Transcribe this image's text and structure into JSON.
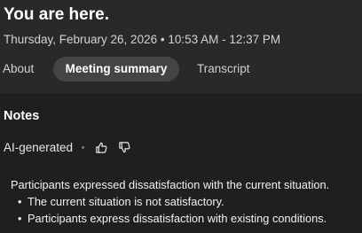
{
  "meeting": {
    "title": "You are here.",
    "datetime": "Thursday, February 26, 2026 • 10:53 AM - 12:37 PM"
  },
  "tabs": [
    {
      "label": "About",
      "selected": false
    },
    {
      "label": "Meeting summary",
      "selected": true
    },
    {
      "label": "Transcript",
      "selected": false
    }
  ],
  "notes": {
    "heading": "Notes",
    "ai_label": "AI-generated",
    "feedback_icons": [
      "thumbs-up-icon",
      "thumbs-down-icon"
    ],
    "summary": "Participants expressed dissatisfaction with the current situation.",
    "bullets": [
      "The current situation is not satisfactory.",
      "Participants express dissatisfaction with existing conditions."
    ]
  },
  "colors": {
    "background": "#1f1f1f",
    "header_background": "#292929",
    "selected_tab_background": "#444444",
    "text": "#ffffff",
    "secondary_text": "#d2d2d2"
  }
}
